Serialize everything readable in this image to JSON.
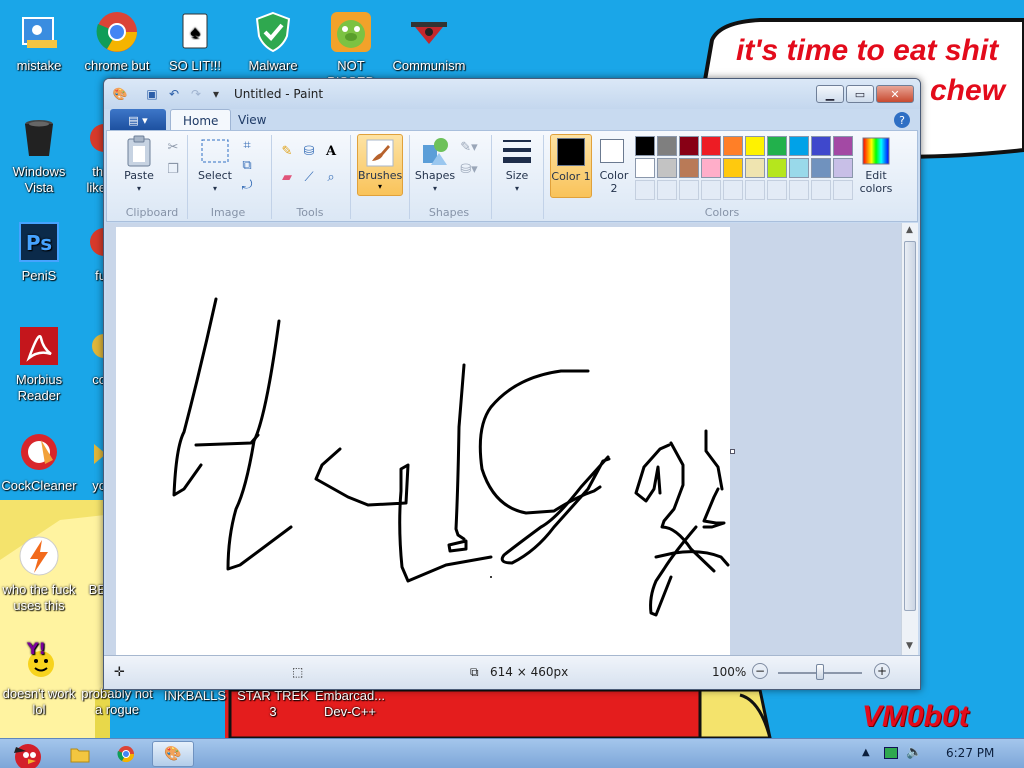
{
  "wallpaper": {
    "speech_line1": "it's time to eat shit",
    "speech_line2": "chew",
    "signature": "VM0b0t"
  },
  "desktop_icons": [
    {
      "label": "mistake",
      "icon": "folder-desktop-icon"
    },
    {
      "label": "chrome but no",
      "icon": "chrome-icon"
    },
    {
      "label": "SO LIT!!!",
      "icon": "playing-card-icon"
    },
    {
      "label": "Malware",
      "icon": "shield-check-icon"
    },
    {
      "label": "NOT PISSED",
      "icon": "green-pig-icon"
    },
    {
      "label": "Communism",
      "icon": "communism-icon"
    },
    {
      "label": "Windows Vista",
      "icon": "recycle-bin-icon"
    },
    {
      "label": "thi like",
      "icon": "red-app-icon"
    },
    {
      "label": "PeniS",
      "icon": "photoshop-icon"
    },
    {
      "label": "fu",
      "icon": "red-app-icon"
    },
    {
      "label": "Morbius Reader",
      "icon": "acrobat-icon"
    },
    {
      "label": "co",
      "icon": "yellow-app-icon"
    },
    {
      "label": "CockCleaner",
      "icon": "ccleaner-icon"
    },
    {
      "label": "yo",
      "icon": "yellow-app-icon"
    },
    {
      "label": "who the fuck uses this",
      "icon": "lightning-icon"
    },
    {
      "label": "BE",
      "icon": "yellow-app-icon"
    },
    {
      "label": "doesn't work lol",
      "icon": "yahoo-icon"
    },
    {
      "label": "probably not a rogue",
      "icon": "shortcut-icon"
    },
    {
      "label": "INKBALLS",
      "icon": "none"
    },
    {
      "label": "STAR TREK 3",
      "icon": "none"
    },
    {
      "label": "Embarcad... Dev-C++",
      "icon": "none"
    }
  ],
  "paint": {
    "title": "Untitled - Paint",
    "file_tab": "▤ ▾",
    "tabs": [
      "Home",
      "View"
    ],
    "groups": {
      "clipboard": "Clipboard",
      "image": "Image",
      "tools": "Tools",
      "shapes": "Shapes",
      "colors": "Colors"
    },
    "buttons": {
      "paste": "Paste",
      "select": "Select",
      "brushes": "Brushes",
      "shapes": "Shapes",
      "size": "Size",
      "color1": "Color 1",
      "color2": "Color 2",
      "edit_colors": "Edit colors"
    },
    "palette_row1": [
      "#000000",
      "#7f7f7f",
      "#880015",
      "#ed1c24",
      "#ff7f27",
      "#fff200",
      "#22b14c",
      "#00a2e8",
      "#3f48cc",
      "#a349a4"
    ],
    "palette_row2": [
      "#ffffff",
      "#c3c3c3",
      "#b97a57",
      "#ffaec9",
      "#ffc90e",
      "#efe4b0",
      "#b5e61d",
      "#99d9ea",
      "#7092be",
      "#c8bfe7"
    ],
    "color1_value": "#000000",
    "color2_value": "#ffffff",
    "status": {
      "dimensions": "614 × 460px",
      "zoom": "100%"
    }
  },
  "taskbar": {
    "clock": "6:27 PM"
  }
}
